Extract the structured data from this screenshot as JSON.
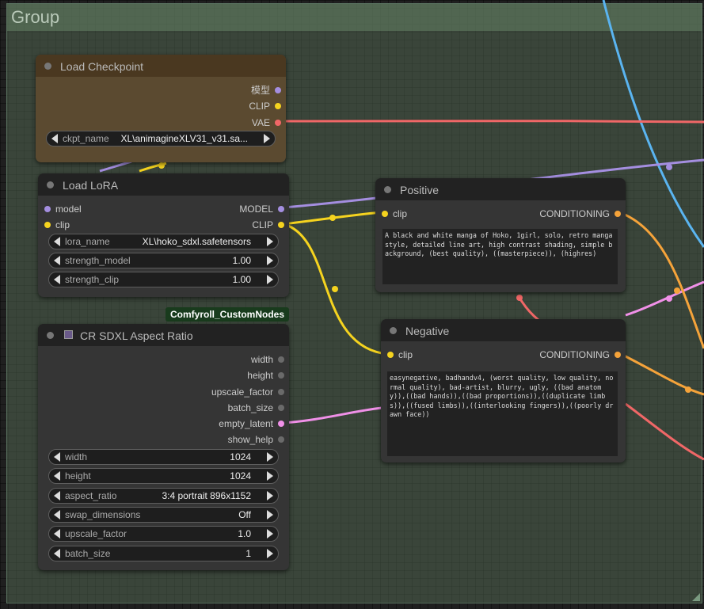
{
  "group": {
    "title": "Group"
  },
  "colors": {
    "model": "#a48ee0",
    "clip": "#f5d31f",
    "vae": "#f06767",
    "conditioning": "#f5a33a",
    "latent": "#f090e8",
    "image_link": "#5ab4f0"
  },
  "load_checkpoint": {
    "title": "Load Checkpoint",
    "outputs": [
      "模型",
      "CLIP",
      "VAE"
    ],
    "ckpt_name_label": "ckpt_name",
    "ckpt_name_value": "XL\\animagineXLV31_v31.sa..."
  },
  "load_lora": {
    "title": "Load LoRA",
    "inputs": [
      "model",
      "clip"
    ],
    "outputs": [
      "MODEL",
      "CLIP"
    ],
    "widgets": [
      {
        "label": "lora_name",
        "value": "XL\\hoko_sdxl.safetensors"
      },
      {
        "label": "strength_model",
        "value": "1.00"
      },
      {
        "label": "strength_clip",
        "value": "1.00"
      }
    ]
  },
  "positive": {
    "title": "Positive",
    "input": "clip",
    "output": "CONDITIONING",
    "text": "A black and white manga of Hoko, 1girl, solo, retro manga style, detailed line art, high contrast shading, simple background, (best quality), ((masterpiece)), (highres)"
  },
  "negative": {
    "title": "Negative",
    "input": "clip",
    "output": "CONDITIONING",
    "text": "easynegative, badhandv4, (worst quality, low quality, normal quality), bad-artist, blurry, ugly, ((bad anatomy)),((bad hands)),((bad proportions)),((duplicate limbs)),((fused limbs)),((interlooking fingers)),((poorly drawn face))"
  },
  "custom_badge": "Comfyroll_CustomNodes",
  "aspect_ratio": {
    "title": "CR SDXL Aspect Ratio",
    "outputs": [
      "width",
      "height",
      "upscale_factor",
      "batch_size",
      "empty_latent",
      "show_help"
    ],
    "widgets": [
      {
        "label": "width",
        "value": "1024"
      },
      {
        "label": "height",
        "value": "1024"
      },
      {
        "label": "aspect_ratio",
        "value": "3:4 portrait 896x1152"
      },
      {
        "label": "swap_dimensions",
        "value": "Off"
      },
      {
        "label": "upscale_factor",
        "value": "1.0"
      },
      {
        "label": "batch_size",
        "value": "1"
      }
    ]
  }
}
